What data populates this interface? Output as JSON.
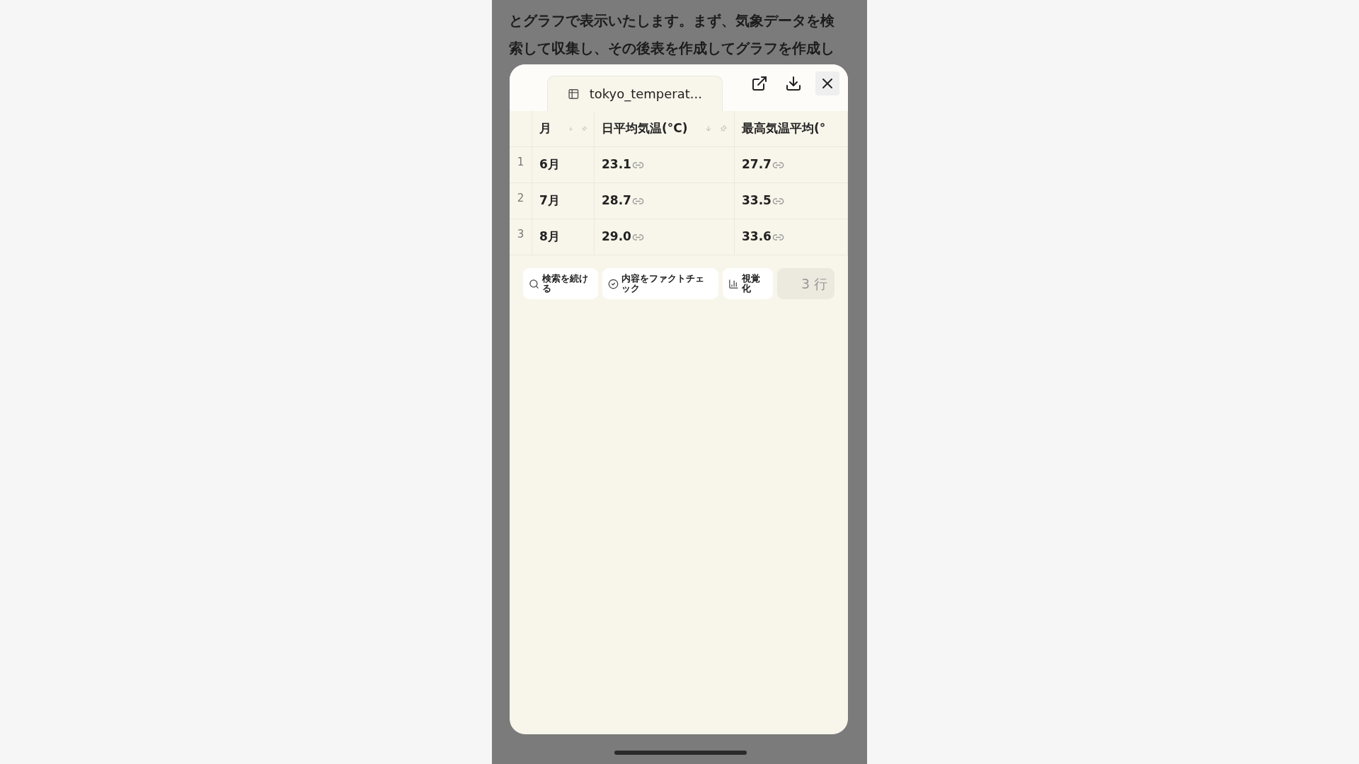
{
  "background_text": "とグラフで表示いたします。まず、気象データを検索して収集し、その後表を作成してグラフを作成し",
  "modal": {
    "tab": {
      "title": "tokyo_temperat..."
    },
    "toolbar": [
      {
        "kind": "open"
      },
      {
        "kind": "download"
      },
      {
        "kind": "close"
      }
    ],
    "table": {
      "columns": [
        {
          "label": "月",
          "kind": "sortable"
        },
        {
          "label": "日平均気温(°C)",
          "kind": "sortable"
        },
        {
          "label": "最高気温平均(°",
          "kind": "plain"
        }
      ],
      "rows": [
        {
          "number": "1",
          "cells": [
            {
              "text": "6月",
              "kind": "plain"
            },
            {
              "text": "23.1",
              "kind": "sourced"
            },
            {
              "text": "27.7",
              "kind": "sourced"
            }
          ]
        },
        {
          "number": "2",
          "cells": [
            {
              "text": "7月",
              "kind": "plain"
            },
            {
              "text": "28.7",
              "kind": "sourced"
            },
            {
              "text": "33.5",
              "kind": "sourced"
            }
          ]
        },
        {
          "number": "3",
          "cells": [
            {
              "text": "8月",
              "kind": "plain"
            },
            {
              "text": "29.0",
              "kind": "sourced"
            },
            {
              "text": "33.6",
              "kind": "sourced"
            }
          ]
        }
      ]
    },
    "actions": [
      {
        "label": "検索を続ける",
        "kind": "search"
      },
      {
        "label": "内容をファクトチェック",
        "kind": "factcheck"
      },
      {
        "label": "視覚化",
        "kind": "visualize"
      }
    ],
    "row_count": "3 行"
  }
}
